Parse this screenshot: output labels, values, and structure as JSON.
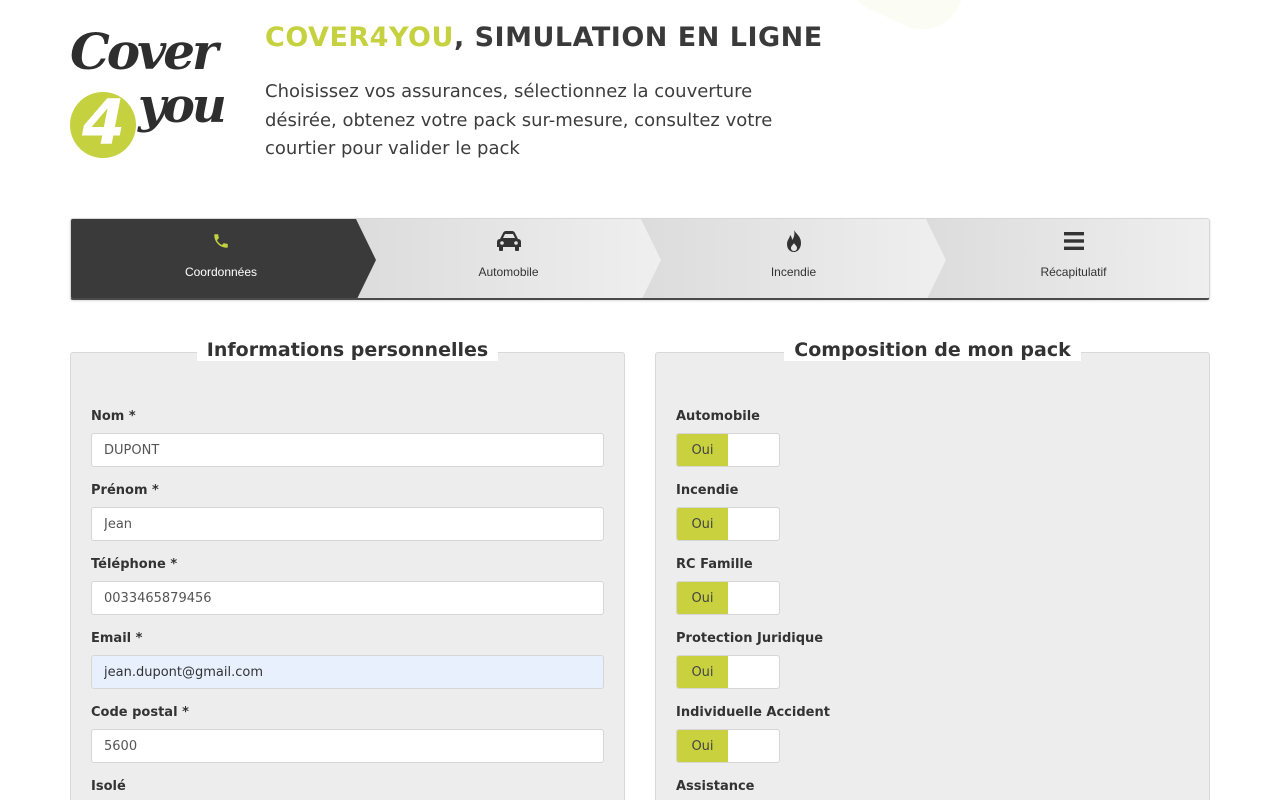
{
  "header": {
    "logo": {
      "line1": "Cover",
      "digit": "4",
      "line2": "you"
    },
    "title_brand": "COVER4YOU",
    "title_rest": ", SIMULATION EN LIGNE",
    "description": "Choisissez vos assurances, sélectionnez la couverture désirée, obtenez votre pack sur-mesure, consultez votre courtier pour valider le pack"
  },
  "stepper": {
    "steps": [
      {
        "label": "Coordonnées",
        "icon": "phone-icon",
        "active": true
      },
      {
        "label": "Automobile",
        "icon": "car-icon",
        "active": false
      },
      {
        "label": "Incendie",
        "icon": "fire-icon",
        "active": false
      },
      {
        "label": "Récapitulatif",
        "icon": "list-icon",
        "active": false
      }
    ]
  },
  "personal": {
    "legend": "Informations personnelles",
    "fields": [
      {
        "label": "Nom *",
        "value": "DUPONT"
      },
      {
        "label": "Prénom *",
        "value": "Jean"
      },
      {
        "label": "Téléphone *",
        "value": "0033465879456"
      },
      {
        "label": "Email *",
        "value": "jean.dupont@gmail.com"
      },
      {
        "label": "Code postal *",
        "value": "5600"
      },
      {
        "label": "Isolé"
      }
    ]
  },
  "pack": {
    "legend": "Composition de mon pack",
    "items": [
      {
        "label": "Automobile",
        "toggle": "Oui"
      },
      {
        "label": "Incendie",
        "toggle": "Oui"
      },
      {
        "label": "RC Famille",
        "toggle": "Oui"
      },
      {
        "label": "Protection Juridique",
        "toggle": "Oui"
      },
      {
        "label": "Individuelle Accident",
        "toggle": "Oui"
      },
      {
        "label": "Assistance"
      }
    ]
  },
  "colors": {
    "brand_green": "#c5d13f",
    "dark": "#3a3a3a",
    "autofill": "#e8f0fe"
  }
}
